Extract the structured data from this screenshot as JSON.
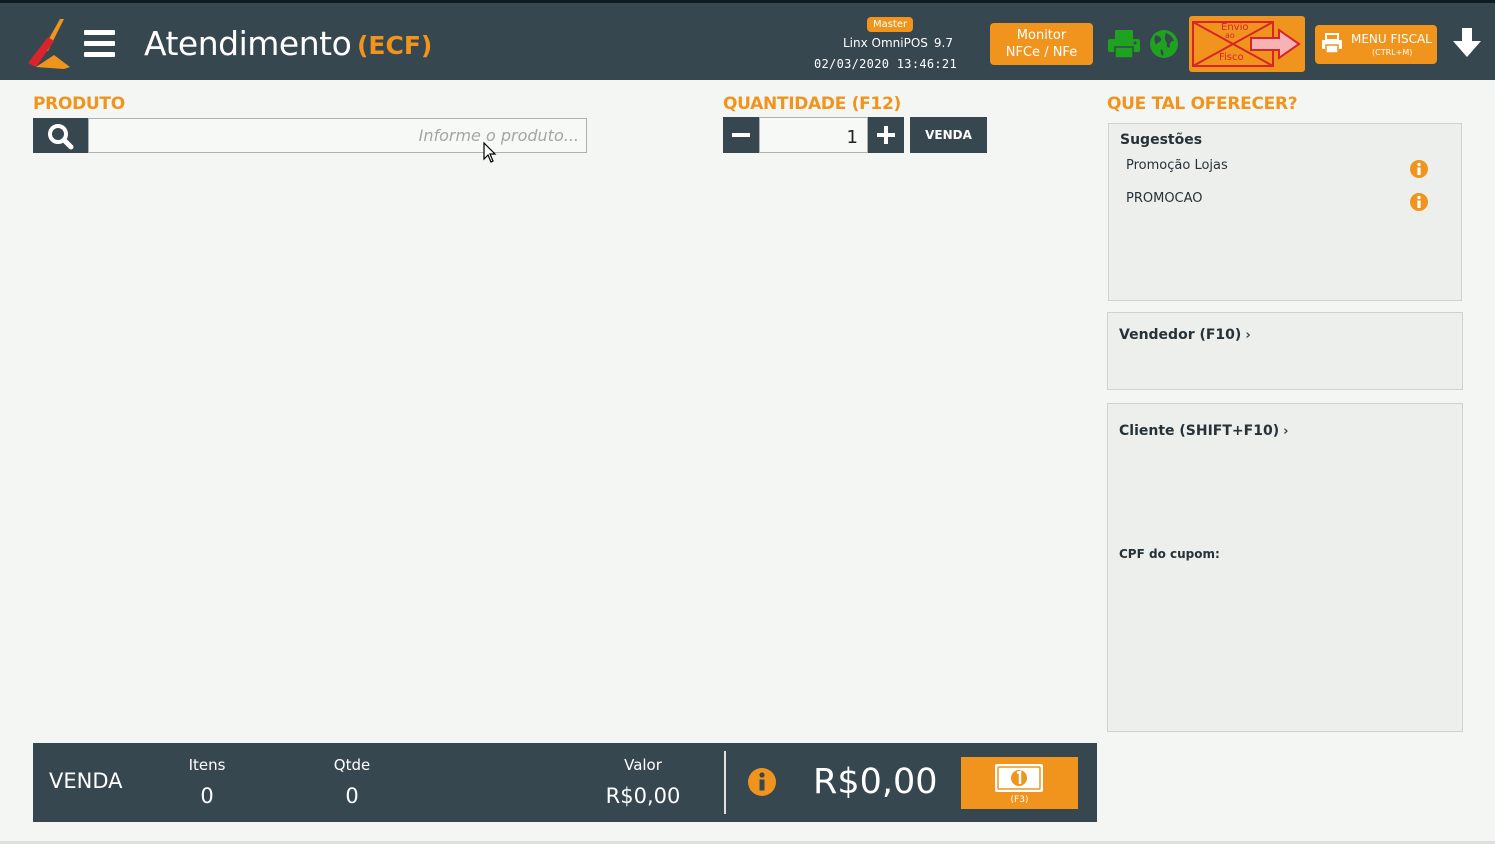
{
  "header": {
    "title": "Atendimento",
    "subtitle": "(ECF)",
    "badge": "Master",
    "system_name": "Linx OmniPOS",
    "system_version": "9.7",
    "datetime": "02/03/2020 13:46:21",
    "monitor_label_line1": "Monitor",
    "monitor_label_line2": "NFCe / NFe",
    "envio_line1": "Envio",
    "envio_line2": "ao",
    "envio_line3": "Fisco",
    "menu_fiscal_label": "MENU FISCAL",
    "menu_fiscal_shortcut": "(CTRL+M)"
  },
  "produto": {
    "label": "PRODUTO",
    "placeholder": "Informe o produto..."
  },
  "quantidade": {
    "label": "QUANTIDADE (F12)",
    "value": "1",
    "venda_button": "VENDA"
  },
  "sugestoes": {
    "heading": "QUE TAL OFERECER?",
    "title": "Sugestões",
    "items": [
      {
        "label": "Promoção Lojas"
      },
      {
        "label": "PROMOCAO"
      }
    ]
  },
  "vendedor": {
    "title": "Vendedor (F10)"
  },
  "cliente": {
    "title": "Cliente (SHIFT+F10)",
    "cpf_label": "CPF do cupom:"
  },
  "footer": {
    "venda_label": "VENDA",
    "itens_label": "Itens",
    "itens_value": "0",
    "qtde_label": "Qtde",
    "qtde_value": "0",
    "valor_label": "Valor",
    "valor_value": "R$0,00",
    "total": "R$0,00",
    "pay_shortcut": "(F3)"
  },
  "colors": {
    "header_bg": "#37474f",
    "accent_orange": "#f0941d",
    "icon_green": "#1fa21f",
    "alert_red": "#d8242a",
    "page_bg": "#f3f6f3"
  },
  "icons": {
    "logo": "linx-logo",
    "menu": "hamburger-icon",
    "printer": "printer-icon",
    "globe": "globe-icon",
    "envio": "envelope-arrow-icon",
    "menu_fiscal": "printer-icon",
    "download": "arrow-down-icon",
    "search": "search-icon",
    "info": "info-icon",
    "pay": "cash-icon"
  }
}
